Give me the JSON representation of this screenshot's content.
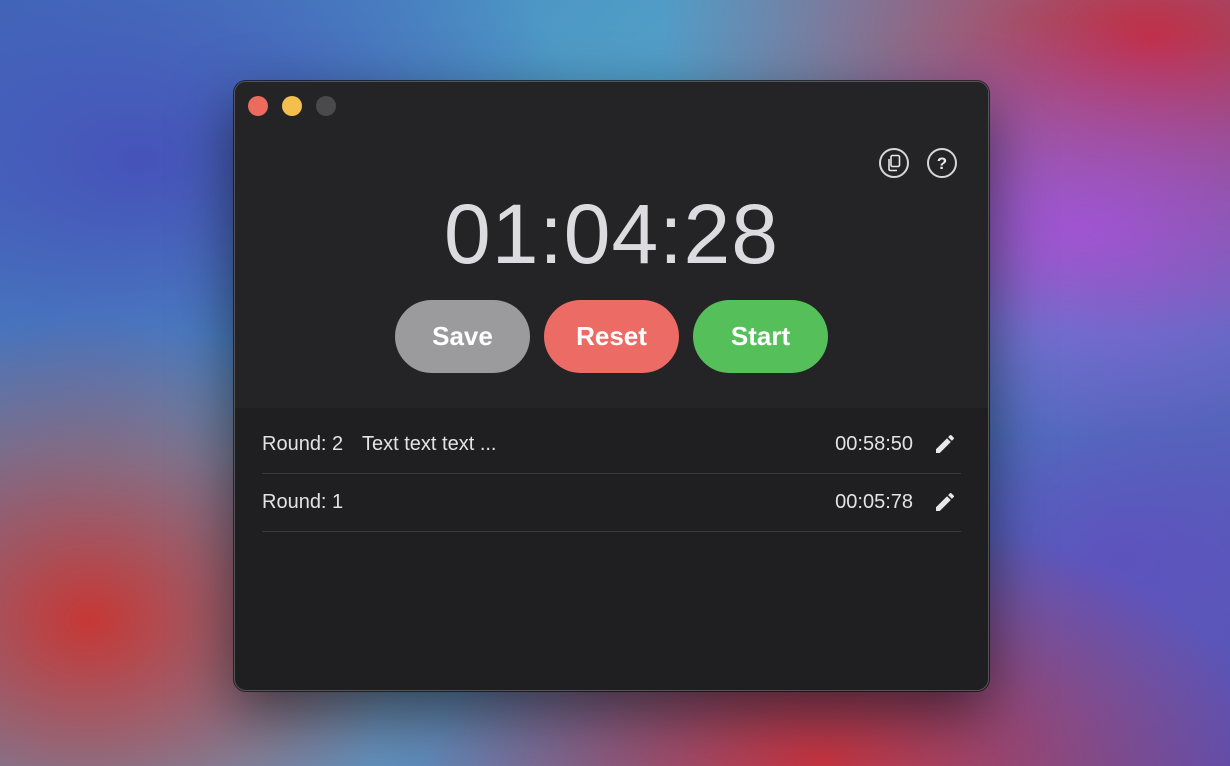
{
  "window": {
    "timer": "01:04:28",
    "buttons": {
      "save_label": "Save",
      "reset_label": "Reset",
      "start_label": "Start"
    },
    "help_label": "?",
    "icons": {
      "copy": "copy-icon",
      "help": "help-icon",
      "edit": "pencil-icon"
    },
    "rounds": [
      {
        "label": "Round: 2",
        "note": "Text text text ...",
        "time": "00:58:50"
      },
      {
        "label": "Round: 1",
        "note": "",
        "time": "00:05:78"
      }
    ]
  },
  "colors": {
    "close": "#ec6b5f",
    "minimize": "#f4bf4f",
    "save": "#9b9b9e",
    "reset": "#ec6b65",
    "start": "#55c05a"
  }
}
